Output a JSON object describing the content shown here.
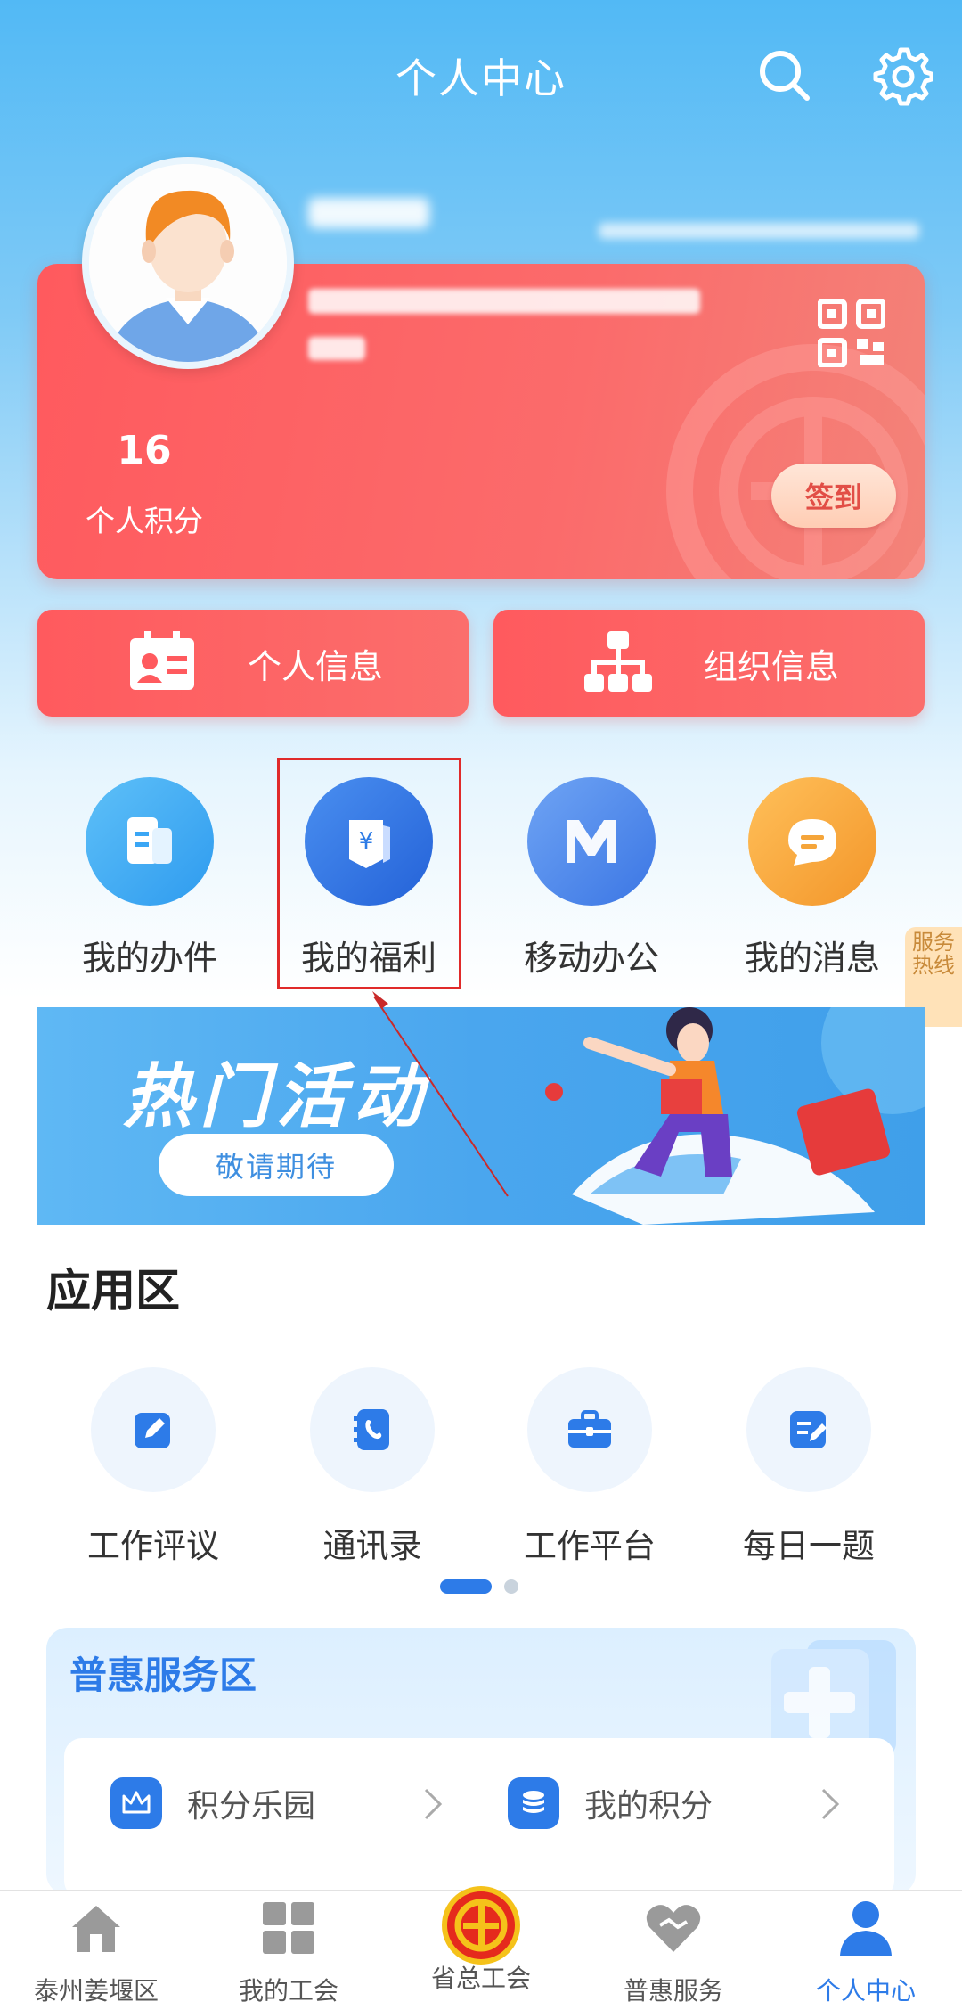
{
  "header": {
    "title": "个人中心"
  },
  "profile": {
    "points_value": "16",
    "points_label": "个人积分",
    "sign_in": "签到"
  },
  "info_buttons": [
    {
      "label": "个人信息"
    },
    {
      "label": "组织信息"
    }
  ],
  "quick_actions": [
    {
      "label": "我的办件",
      "icon": "document-icon",
      "color": "#3aa6f5"
    },
    {
      "label": "我的福利",
      "icon": "welfare-icon",
      "color": "#2e7ce6"
    },
    {
      "label": "移动办公",
      "icon": "mobile-office-icon",
      "color": "#4f8df0"
    },
    {
      "label": "我的消息",
      "icon": "message-icon",
      "color": "#f5a53a"
    }
  ],
  "hotline": {
    "label": "服务热线"
  },
  "banner": {
    "title": "热门活动",
    "button": "敬请期待"
  },
  "app_section": {
    "title": "应用区",
    "apps": [
      {
        "label": "工作评议",
        "icon": "edit-icon"
      },
      {
        "label": "通讯录",
        "icon": "contacts-icon"
      },
      {
        "label": "工作平台",
        "icon": "briefcase-icon"
      },
      {
        "label": "每日一题",
        "icon": "quiz-icon"
      }
    ]
  },
  "service_section": {
    "title": "普惠服务区",
    "items": [
      {
        "label": "积分乐园",
        "icon": "crown-icon"
      },
      {
        "label": "我的积分",
        "icon": "coins-icon"
      }
    ]
  },
  "bottom_nav": [
    {
      "label": "泰州姜堰区",
      "icon": "home-icon"
    },
    {
      "label": "我的工会",
      "icon": "grid-icon"
    },
    {
      "label": "省总工会",
      "icon": "union-emblem-icon"
    },
    {
      "label": "普惠服务",
      "icon": "heart-icon"
    },
    {
      "label": "个人中心",
      "icon": "person-icon",
      "active": true
    }
  ],
  "colors": {
    "brand_red": "#ff5a5e",
    "accent_blue": "#2d7be8"
  }
}
